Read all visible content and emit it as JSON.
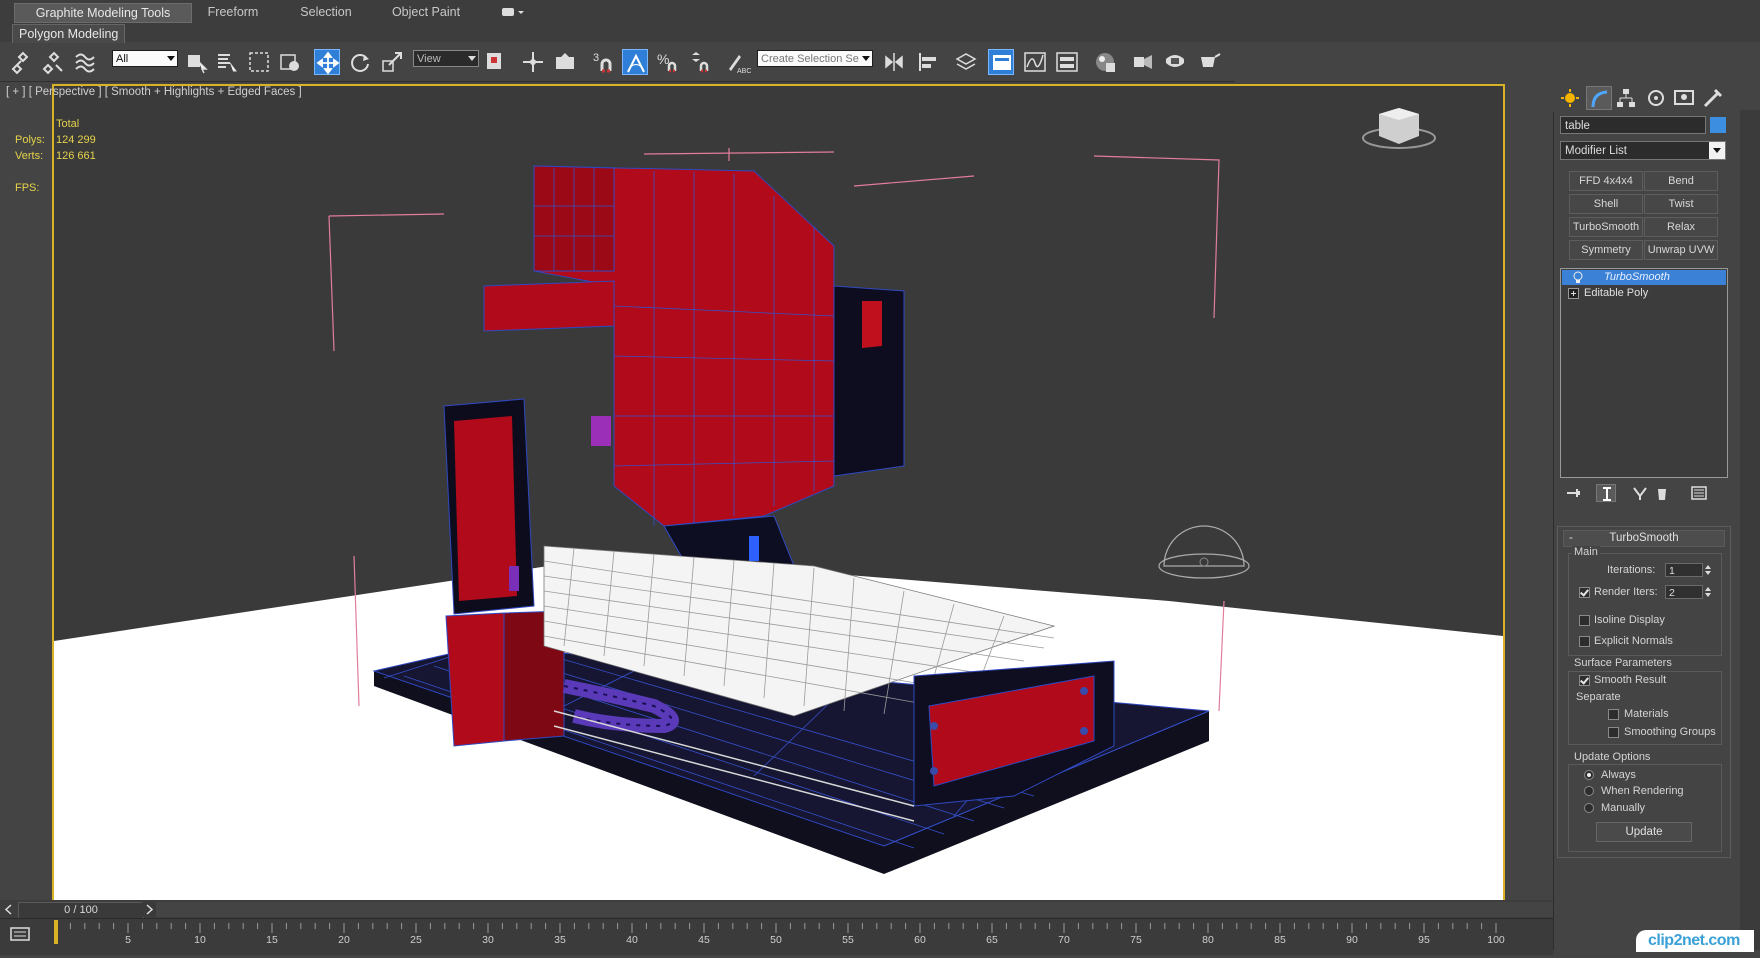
{
  "ribbon": {
    "tabs": [
      {
        "label": "Graphite Modeling Tools",
        "active": true
      },
      {
        "label": "Freeform",
        "active": false
      },
      {
        "label": "Selection",
        "active": false
      },
      {
        "label": "Object Paint",
        "active": false
      }
    ],
    "sub_label": "Polygon Modeling"
  },
  "toolbar": {
    "selection_filter": "All",
    "ref_coord": "View",
    "named_selection_placeholder": "Create Selection Se",
    "snap_label": "3",
    "icons": [
      "link-icon",
      "unlink-icon",
      "bind-space-warp-icon",
      "select-object-icon",
      "select-by-name-icon",
      "rect-selection-icon",
      "window-crossing-icon",
      "move-icon",
      "rotate-icon",
      "scale-icon",
      "pivot-icon",
      "manipulate-icon",
      "keyboard-shortcut-icon",
      "snap-icon",
      "angle-snap-icon",
      "percent-snap-icon",
      "spinner-snap-icon",
      "edit-named-sets-icon",
      "mirror-icon",
      "align-icon",
      "layer-manager-icon",
      "graphite-toggle-icon",
      "curve-editor-icon",
      "schematic-view-icon",
      "material-editor-icon",
      "render-setup-icon",
      "rendered-frame-icon",
      "render-icon"
    ]
  },
  "viewport": {
    "label": "[ + ] [ Perspective ] [ Smooth + Highlights + Edged Faces ]",
    "stats_total": "Total",
    "polys_label": "Polys:",
    "polys_value": "124 299",
    "verts_label": "Verts:",
    "verts_value": "126 661",
    "fps_label": "FPS:"
  },
  "command_panel": {
    "object_name": "table",
    "object_color": "#3c8fe0",
    "modifier_list": "Modifier List",
    "modifier_buttons": [
      "FFD 4x4x4",
      "Bend",
      "Shell",
      "Twist",
      "TurboSmooth",
      "Relax",
      "Symmetry",
      "Unwrap UVW"
    ],
    "stack": [
      {
        "label": "TurboSmooth",
        "selected": true
      },
      {
        "label": "Editable Poly",
        "selected": false
      }
    ],
    "rollout": {
      "title": "TurboSmooth",
      "main_label": "Main",
      "iterations_label": "Iterations:",
      "iterations_value": "1",
      "render_iters_label": "Render Iters:",
      "render_iters_value": "2",
      "render_iters_checked": true,
      "isoline_label": "Isoline Display",
      "explicit_normals_label": "Explicit Normals",
      "surface_params_label": "Surface Parameters",
      "smooth_result_label": "Smooth Result",
      "separate_label": "Separate",
      "materials_label": "Materials",
      "smoothing_groups_label": "Smoothing Groups",
      "update_options_label": "Update Options",
      "always_label": "Always",
      "when_rendering_label": "When Rendering",
      "manually_label": "Manually",
      "update_button": "Update"
    }
  },
  "timeline": {
    "frame_display": "0 / 100",
    "ticks": [
      "5",
      "10",
      "15",
      "20",
      "25",
      "30",
      "35",
      "40",
      "45",
      "50",
      "55",
      "60",
      "65",
      "70",
      "75",
      "80",
      "85",
      "90",
      "95",
      "100"
    ]
  },
  "watermark": "clip2net.com"
}
